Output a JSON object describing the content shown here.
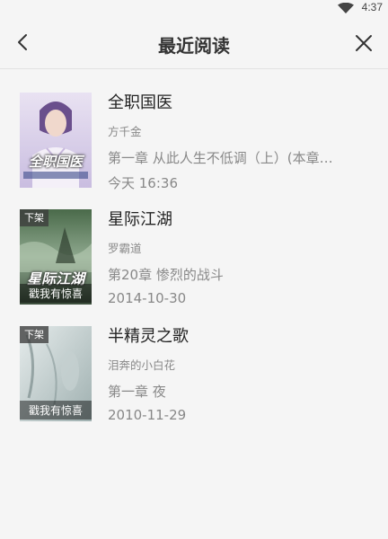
{
  "status_bar": {
    "time": "4:37",
    "wifi_icon": "wifi-icon"
  },
  "header": {
    "title": "最近阅读",
    "back_icon": "back-arrow-icon",
    "close_icon": "close-icon"
  },
  "books": [
    {
      "title": "全职国医",
      "author": "方千金",
      "chapter": "第一章 从此人生不低调（上）(本章…",
      "date": "今天 16:36",
      "cover_title": "全职国医",
      "badge": "",
      "promo": ""
    },
    {
      "title": "星际江湖",
      "author": "罗霸道",
      "chapter": "第20章 惨烈的战斗",
      "date": "2014-10-30",
      "cover_title": "星际江湖",
      "badge": "下架",
      "promo": "戳我有惊喜"
    },
    {
      "title": "半精灵之歌",
      "author": "泪奔的小白花",
      "chapter": "第一章  夜",
      "date": "2010-11-29",
      "cover_title": "",
      "badge": "下架",
      "promo": "戳我有惊喜"
    }
  ],
  "colors": {
    "background": "#f5f5f5",
    "divider": "#e2e2e2",
    "text_secondary": "#888888"
  }
}
